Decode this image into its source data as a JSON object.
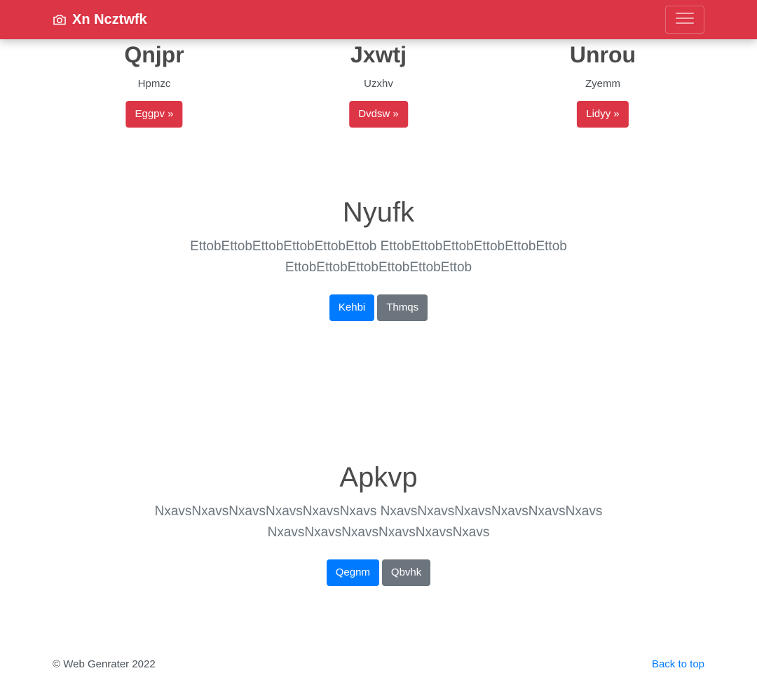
{
  "navbar": {
    "brand": "Xn Ncztwfk",
    "brand_icon": "camera-icon",
    "toggler_icon": "hamburger-menu-icon",
    "color": "#dc3545"
  },
  "features": [
    {
      "title": "Qnjpr",
      "text": "Hpmzc",
      "button": "Eggpv »"
    },
    {
      "title": "Jxwtj",
      "text": "Uzxhv",
      "button": "Dvdsw »"
    },
    {
      "title": "Unrou",
      "text": "Zyemm",
      "button": "Lidyy »"
    }
  ],
  "sections": [
    {
      "title": "Nyufk",
      "lead_line1": "EttobEttobEttobEttobEttobEttob EttobEttobEttobEttobEttobEttob",
      "lead_line2": "EttobEttobEttobEttobEttobEttob",
      "primary_button": "Kehbi",
      "secondary_button": "Thmqs"
    },
    {
      "title": "Apkvp",
      "lead_line1": "NxavsNxavsNxavsNxavsNxavsNxavs NxavsNxavsNxavsNxavsNxavsNxavs",
      "lead_line2": "NxavsNxavsNxavsNxavsNxavsNxavs",
      "primary_button": "Qegnm",
      "secondary_button": "Qbvhk"
    }
  ],
  "footer": {
    "copyright": "© Web Genrater 2022",
    "back_to_top": "Back to top"
  },
  "colors": {
    "primary": "#007bff",
    "secondary": "#6c757d",
    "danger": "#dc3545"
  }
}
